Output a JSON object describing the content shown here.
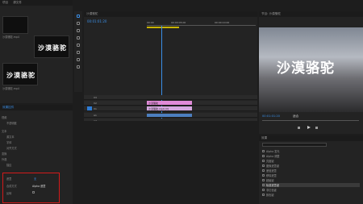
{
  "project": {
    "tabs": [
      "项目",
      "源文件",
      "效果控件"
    ],
    "items": [
      {
        "label": "沙漠骆驼.mp4",
        "title": "沙漠骆驼"
      },
      {
        "label": "沙漠骆驼.mp4",
        "title": "沙漠骆驼"
      }
    ]
  },
  "effects_panel": {
    "tab": "效果控件",
    "rows": [
      "视频",
      "不透明度",
      "文本",
      "源文本",
      "字体",
      "对齐方式",
      "变换",
      "外观",
      "描边"
    ],
    "bottom_props": [
      {
        "label": "遮罩",
        "value": "无"
      },
      {
        "label": "合成方式",
        "value": "Alpha 遮罩"
      },
      {
        "label": "反转",
        "value": ""
      }
    ]
  },
  "timeline": {
    "sequence_name": "沙漠骆驼",
    "timecode": "00:01:01:20",
    "ruler_marks": [
      "00:00",
      "00:00:05:00",
      "00:00:10:00"
    ],
    "tracks_video": [
      "V3",
      "V2",
      "V1"
    ],
    "tracks_audio": [
      "A1",
      "A2",
      "A3"
    ],
    "clips": [
      {
        "label": "沙漠骆驼",
        "track": "V2",
        "color": "#e08ad8"
      },
      {
        "label": "沙漠骆驼.mp4 [V]",
        "track": "V1",
        "color": "#d5a8e0"
      }
    ]
  },
  "program": {
    "title": "节目: 沙漠骆驼",
    "overlay_text": "沙漠骆驼",
    "timecode": "00:01:01:20",
    "zoom": "适合"
  },
  "effects_list": {
    "tab": "效果",
    "items": [
      "Alpha 发光",
      "Alpha 调整",
      "亮度键",
      "图像遮罩键",
      "差值遮罩",
      "移除遮罩",
      "超级键",
      "轨道遮罩键",
      "非红色键",
      "颜色键"
    ]
  }
}
